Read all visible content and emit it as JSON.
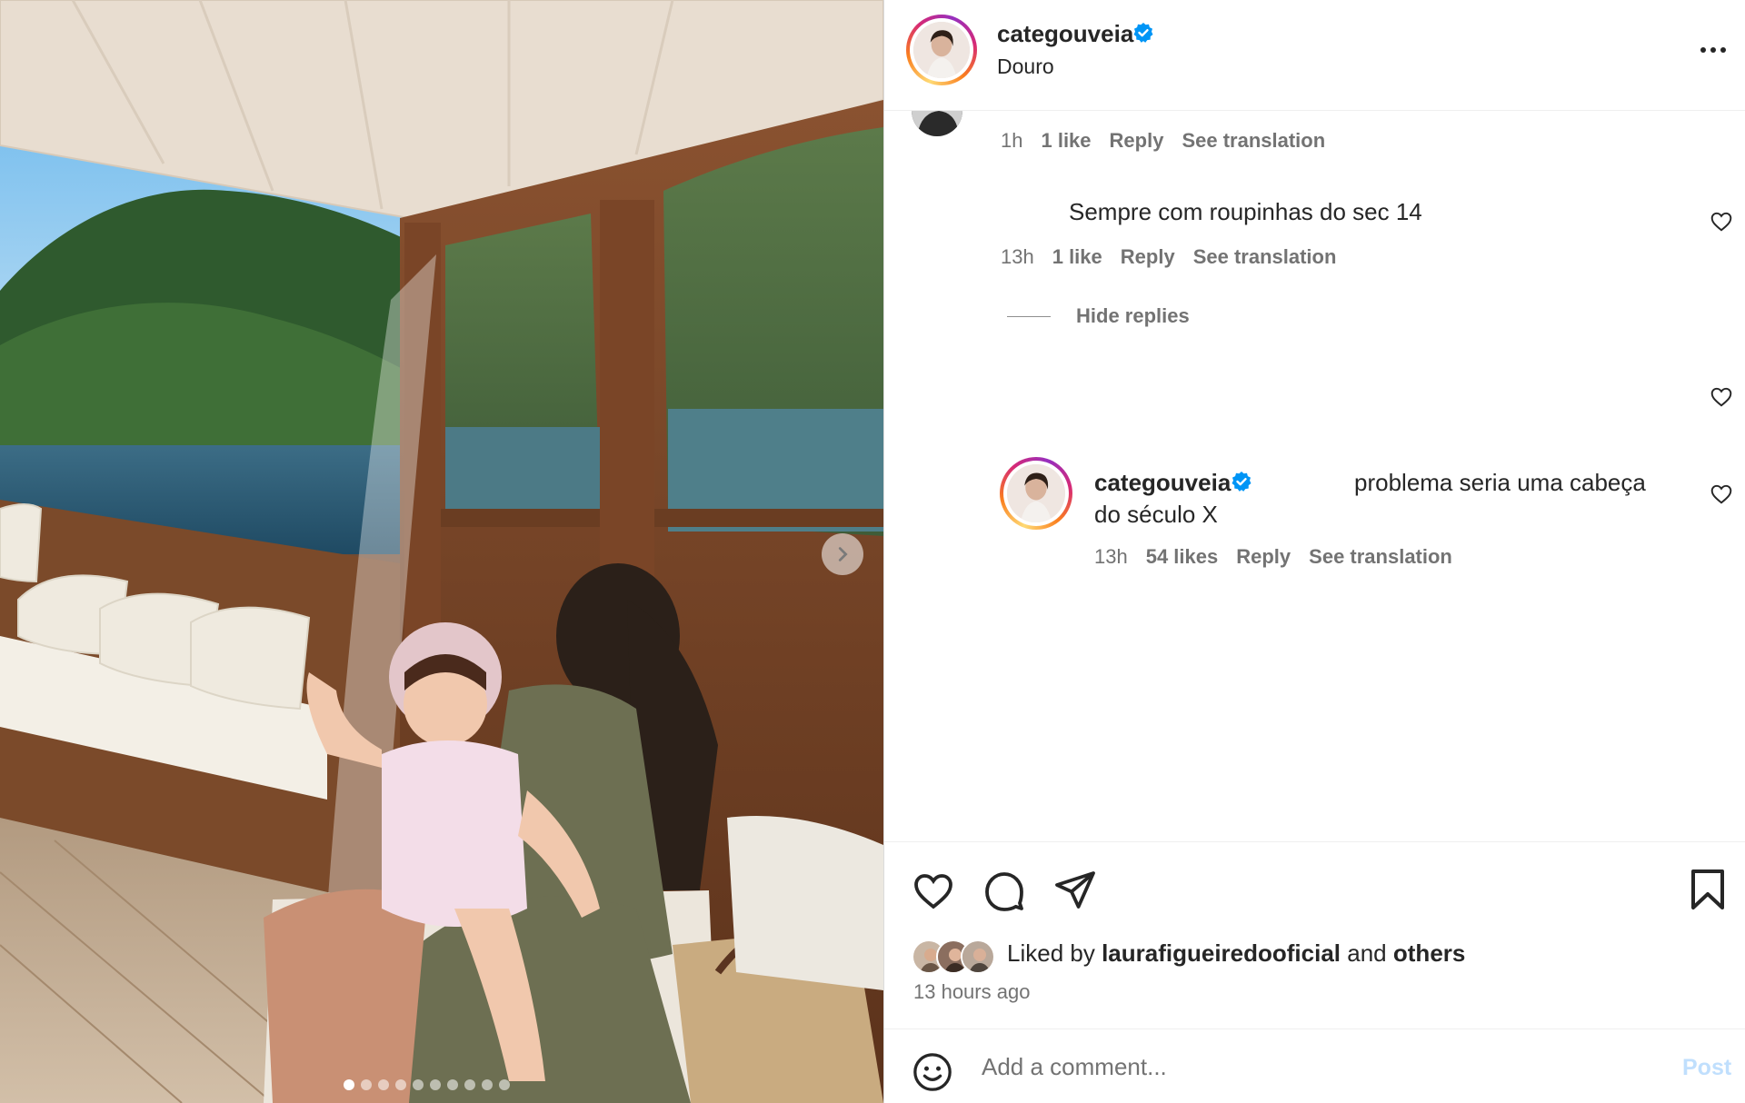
{
  "post": {
    "username": "categouveia",
    "location": "Douro",
    "verified": true,
    "carousel": {
      "slide_count": 10,
      "active_index": 0
    }
  },
  "comments": {
    "first": {
      "time": "1h",
      "likes": "1 like",
      "reply": "Reply",
      "translate": "See translation"
    },
    "second": {
      "text": "Sempre com roupinhas do sec 14",
      "time": "13h",
      "likes": "1 like",
      "reply": "Reply",
      "translate": "See translation"
    },
    "hide_replies": "Hide replies",
    "reply": {
      "username": "categouveia",
      "text_line1": "problema seria uma cabeça",
      "text_line2": "do século X",
      "time": "13h",
      "likes": "54 likes",
      "reply": "Reply",
      "translate": "See translation"
    }
  },
  "actions": {
    "liked_by_prefix": "Liked by",
    "liked_by_user": "laurafigueiredooficial",
    "liked_by_and": "and",
    "liked_by_others": "others",
    "time_ago": "13 hours ago"
  },
  "composer": {
    "placeholder": "Add a comment...",
    "post_label": "Post"
  },
  "colors": {
    "verified": "#0095f6",
    "post_disabled": "#c0dffd",
    "meta_text": "#737373"
  },
  "icons": [
    "next-arrow-icon",
    "more-options-icon",
    "verified-badge-icon",
    "heart-icon",
    "comment-icon",
    "share-icon",
    "bookmark-icon",
    "emoji-icon"
  ]
}
